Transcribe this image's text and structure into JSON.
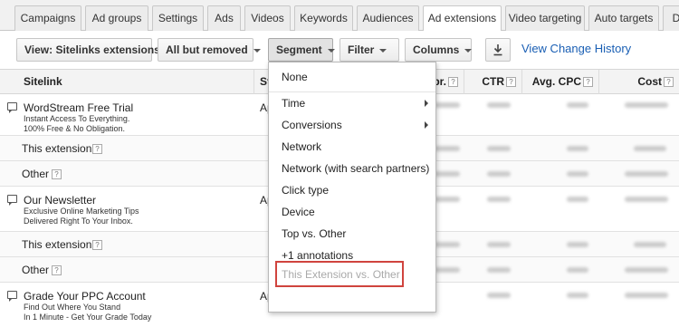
{
  "tabs": [
    {
      "label": "Campaigns",
      "active": false
    },
    {
      "label": "Ad groups",
      "active": false
    },
    {
      "label": "Settings",
      "active": false
    },
    {
      "label": "Ads",
      "active": false
    },
    {
      "label": "Videos",
      "active": false
    },
    {
      "label": "Keywords",
      "active": false
    },
    {
      "label": "Audiences",
      "active": false
    },
    {
      "label": "Ad extensions",
      "active": true
    },
    {
      "label": "Video targeting",
      "active": false
    },
    {
      "label": "Auto targets",
      "active": false
    },
    {
      "label": "D",
      "active": false
    }
  ],
  "toolbar": {
    "view_label": "View: Sitelinks extensions",
    "filter_status_label": "All but removed",
    "segment_label": "Segment",
    "filter_label": "Filter",
    "columns_label": "Columns",
    "download_icon": "download-icon",
    "history_label": "View Change History"
  },
  "table": {
    "headers": {
      "sitelink": "Sitelink",
      "status": "St",
      "impr": "pr.",
      "ctr": "CTR",
      "avg_cpc": "Avg. CPC",
      "cost": "Cost"
    },
    "rows": [
      {
        "type": "sitelink",
        "title": "WordStream Free Trial",
        "desc1": "Instant Access To Everything.",
        "desc2": "100% Free & No Obligation.",
        "status": "Appr"
      },
      {
        "type": "segment",
        "label": "This extension"
      },
      {
        "type": "segment",
        "label": "Other"
      },
      {
        "type": "sitelink",
        "title": "Our Newsletter",
        "desc1": "Exclusive Online Marketing Tips",
        "desc2": "Delivered Right To Your Inbox.",
        "status": "Ap"
      },
      {
        "type": "segment",
        "label": "This extension"
      },
      {
        "type": "segment",
        "label": "Other"
      },
      {
        "type": "sitelink",
        "title": "Grade Your PPC Account",
        "desc1": "Find Out Where You Stand",
        "desc2": "In 1 Minute - Get Your Grade Today",
        "status": "Approved"
      }
    ]
  },
  "segment_menu": {
    "items": [
      {
        "label": "None",
        "submenu": false,
        "disabled": false
      },
      {
        "label": "Time",
        "submenu": true,
        "disabled": false
      },
      {
        "label": "Conversions",
        "submenu": true,
        "disabled": false
      },
      {
        "label": "Network",
        "submenu": false,
        "disabled": false
      },
      {
        "label": "Network (with search partners)",
        "submenu": false,
        "disabled": false
      },
      {
        "label": "Click type",
        "submenu": false,
        "disabled": false
      },
      {
        "label": "Device",
        "submenu": false,
        "disabled": false
      },
      {
        "label": "Top vs. Other",
        "submenu": false,
        "disabled": false
      },
      {
        "label": "+1 annotations",
        "submenu": false,
        "disabled": false
      },
      {
        "label": "This Extension vs. Other",
        "submenu": false,
        "disabled": true
      }
    ]
  },
  "colors": {
    "accent_link": "#1a5fb4",
    "highlight": "#d0443e"
  }
}
